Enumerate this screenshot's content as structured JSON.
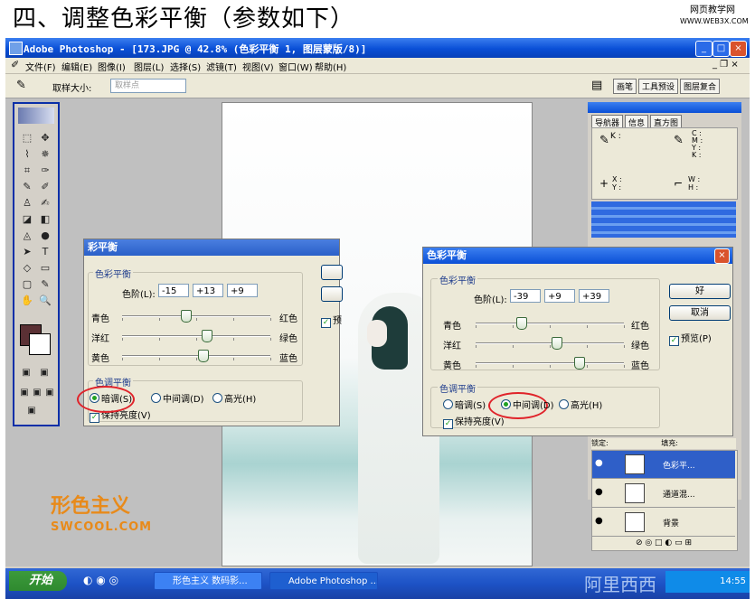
{
  "heading": "四、调整色彩平衡（参数如下）",
  "site_logo": {
    "line1": "网页教学网",
    "line2": "WWW.WEB3X.COM"
  },
  "window": {
    "title": "Adobe Photoshop - [173.JPG @ 42.8% (色彩平衡 1, 图层蒙版/8)]"
  },
  "menu": [
    "文件(F)",
    "编辑(E)",
    "图像(I)",
    "图层(L)",
    "选择(S)",
    "滤镜(T)",
    "视图(V)",
    "窗口(W)",
    "帮助(H)"
  ],
  "options_bar": {
    "sample_size_label": "取样大小:",
    "sample_size_value": "取样点"
  },
  "panel_tabs": [
    "画笔",
    "工具预设",
    "图层复合"
  ],
  "info_panel": {
    "tabs": [
      "导航器",
      "信息",
      "直方图"
    ],
    "k_label": "K :",
    "cmyk": "C :\nM :\nY :\nK :",
    "xy": "X :\nY :",
    "wh": "W :\nH :"
  },
  "layers": {
    "blend_label": "锁定:",
    "fill_label": "填充:",
    "items": [
      {
        "name": "色彩平..."
      },
      {
        "name": "通道混..."
      },
      {
        "name": "背景"
      }
    ]
  },
  "dialog_left": {
    "title": "彩平衡",
    "group_color": "色彩平衡",
    "levels_label": "色阶(L):",
    "levels": [
      "-15",
      "+13",
      "+9"
    ],
    "sliders": [
      {
        "left": "青色",
        "right": "红色",
        "value": -15
      },
      {
        "left": "洋红",
        "right": "绿色",
        "value": 13
      },
      {
        "left": "黄色",
        "right": "蓝色",
        "value": 9
      }
    ],
    "group_tone": "色调平衡",
    "tones": [
      "暗调(S)",
      "中间调(D)",
      "高光(H)"
    ],
    "selected_tone": "暗调(S)",
    "preserve_label": "保持亮度(V)",
    "preview_label": "预"
  },
  "dialog_right": {
    "title": "色彩平衡",
    "group_color": "色彩平衡",
    "levels_label": "色阶(L):",
    "levels": [
      "-39",
      "+9",
      "+39"
    ],
    "sliders": [
      {
        "left": "青色",
        "right": "红色",
        "value": -39
      },
      {
        "left": "洋红",
        "right": "绿色",
        "value": 9
      },
      {
        "left": "黄色",
        "right": "蓝色",
        "value": 39
      }
    ],
    "group_tone": "色调平衡",
    "tones": [
      "暗调(S)",
      "中间调(D)",
      "高光(H)"
    ],
    "selected_tone": "中间调(D)",
    "preserve_label": "保持亮度(V)",
    "ok_label": "好",
    "cancel_label": "取消",
    "preview_label": "预览(P)"
  },
  "watermark": {
    "line1": "形色主义",
    "line2": "SWCOOL.COM"
  },
  "taskbar": {
    "start": "开始",
    "items": [
      "形色主义 数码影...",
      "Adobe Photoshop ..."
    ],
    "clock": "14:55",
    "brand": "阿里西西"
  }
}
